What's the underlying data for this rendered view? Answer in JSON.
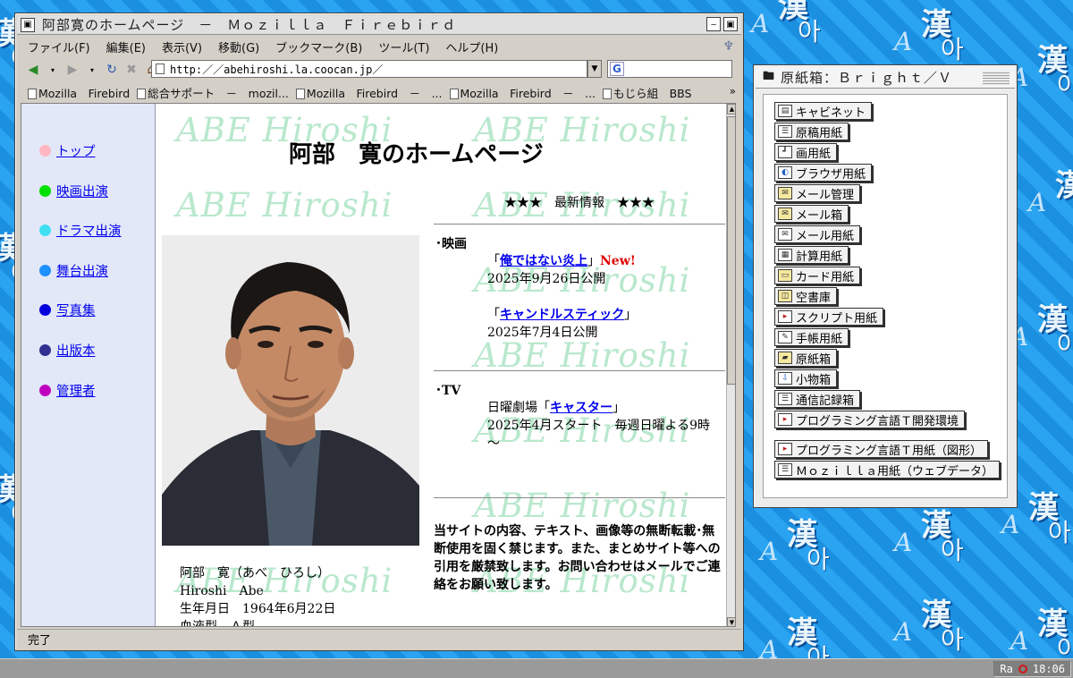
{
  "browser": {
    "title": "阿部寛のホームページ　－　Ｍｏｚｉｌｌａ　Ｆｉｒｅｂｉｒｄ",
    "menu": [
      "ファイル(F)",
      "編集(E)",
      "表示(V)",
      "移動(G)",
      "ブックマーク(B)",
      "ツール(T)",
      "ヘルプ(H)"
    ],
    "url": "http:／／abehiroshi.la.coocan.jp／",
    "search_engine_icon": "G",
    "bookmarks": [
      "Mozilla　Firebird",
      "総合サポート　－　mozil...",
      "Mozilla　Firebird　－　...",
      "Mozilla　Firebird　－　...",
      "もじら組　BBS"
    ],
    "bookmarks_more": "»",
    "status": "完了"
  },
  "site": {
    "watermark": "ABE Hiroshi",
    "heading": "阿部　寛のホームページ",
    "nav": [
      {
        "label": "トップ",
        "color": "#ffb6c1"
      },
      {
        "label": "映画出演",
        "color": "#00e000"
      },
      {
        "label": "ドラマ出演",
        "color": "#40e0f0"
      },
      {
        "label": "舞台出演",
        "color": "#1e90ff"
      },
      {
        "label": "写真集",
        "color": "#0000dd"
      },
      {
        "label": "出版本",
        "color": "#303090"
      },
      {
        "label": "管理者",
        "color": "#c000c0"
      }
    ],
    "profile": {
      "name_jp": "阿部　寛（あべ　ひろし）",
      "name_en": "Hiroshi　Abe",
      "birth": "生年月日　1964年6月22日",
      "blood_partial": "血液型　Ａ型"
    },
    "news": {
      "header": "★★★　最新情報　★★★",
      "movie_label": "･映画",
      "movie1_open": "「",
      "movie1_title": "俺ではない炎上",
      "movie1_close": "」",
      "movie1_new": "New!",
      "movie1_date": "2025年9月26日公開",
      "movie2_open": "「",
      "movie2_title": "キャンドルスティック",
      "movie2_close": "」",
      "movie2_date": "2025年7月4日公開",
      "tv_label": "･TV",
      "tv_prefix": "日曜劇場「",
      "tv_title": "キャスター",
      "tv_close": "」",
      "tv_date": "2025年4月スタート　毎週日曜よる9時～"
    },
    "notice": "当サイトの内容、テキスト、画像等の無断転載･無断使用を固く禁じます。また、まとめサイト等への引用を厳禁致します。お問い合わせはメールでご連絡をお願い致します。"
  },
  "filemanager": {
    "title": "原紙箱：Ｂｒｉｇｈｔ／Ｖ",
    "items": [
      {
        "label": "キャビネット",
        "icon": "cabinet-icon"
      },
      {
        "label": "原稿用紙",
        "icon": "document-icon"
      },
      {
        "label": "画用紙",
        "icon": "drawing-icon"
      },
      {
        "label": "ブラウザ用紙",
        "icon": "browser-icon"
      },
      {
        "label": "メール管理",
        "icon": "mail-manage-icon"
      },
      {
        "label": "メール箱",
        "icon": "mailbox-icon"
      },
      {
        "label": "メール用紙",
        "icon": "mail-paper-icon"
      },
      {
        "label": "計算用紙",
        "icon": "spreadsheet-icon"
      },
      {
        "label": "カード用紙",
        "icon": "card-icon"
      },
      {
        "label": "空書庫",
        "icon": "archive-icon"
      },
      {
        "label": "スクリプト用紙",
        "icon": "script-icon"
      },
      {
        "label": "手帳用紙",
        "icon": "notebook-icon"
      },
      {
        "label": "原紙箱",
        "icon": "template-box-icon"
      },
      {
        "label": "小物箱",
        "icon": "accessory-box-icon"
      },
      {
        "label": "通信記録箱",
        "icon": "comm-log-icon"
      },
      {
        "label": "プログラミング言語Ｔ開発環境",
        "icon": "dev-env-icon"
      },
      {
        "label": "プログラミング言語Ｔ用紙（図形）",
        "icon": "code-paper-icon"
      },
      {
        "label": "Ｍｏｚｉｌｌａ用紙（ウェブデータ）",
        "icon": "web-paper-icon"
      }
    ]
  },
  "taskbar": {
    "indicator": "Ra",
    "clock": "18:06"
  }
}
